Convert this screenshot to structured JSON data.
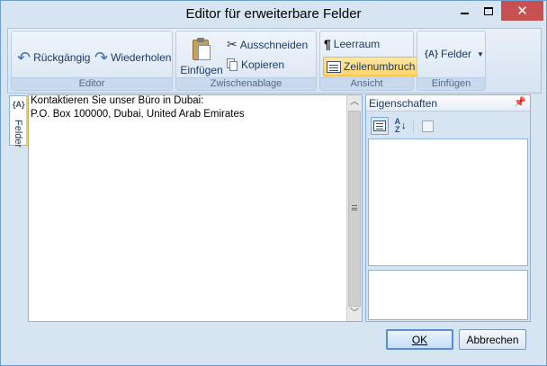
{
  "window": {
    "title": "Editor für erweiterbare Felder"
  },
  "ribbon": {
    "editor": {
      "label": "Editor",
      "undo": "Rückgängig",
      "redo": "Wiederholen"
    },
    "clipboard": {
      "label": "Zwischenablage",
      "paste": "Einfügen",
      "cut": "Ausschneiden",
      "copy": "Kopieren"
    },
    "view": {
      "label": "Ansicht",
      "whitespace": "Leerraum",
      "wordwrap": "Zeilenumbruch"
    },
    "insert": {
      "label": "Einfügen",
      "fields": "Felder",
      "fields_icon_text": "{A}"
    }
  },
  "sidetab": {
    "label": "Felder",
    "icon_text": "{A}"
  },
  "editor": {
    "lines": [
      "Kontaktieren Sie unser Büro in Dubai:",
      "P.O. Box 100000, Dubai, United Arab Emirates"
    ]
  },
  "properties": {
    "title": "Eigenschaften",
    "alpha_top": "A",
    "alpha_bottom": "Z"
  },
  "buttons": {
    "ok": "OK",
    "cancel": "Abbrechen"
  },
  "colors": {
    "window_bg": "#d7e4f2",
    "close_button": "#c75050",
    "active_toggle": "#ffd46a"
  }
}
